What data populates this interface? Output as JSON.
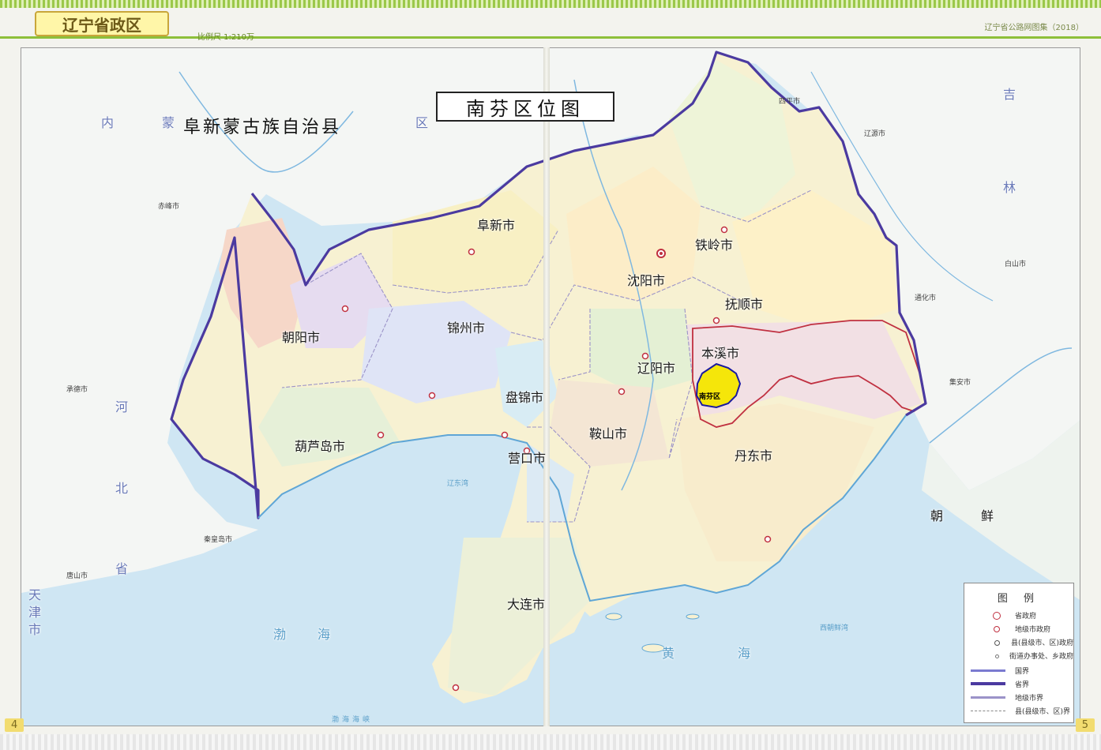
{
  "header": {
    "title": "辽宁省政区",
    "scale": "比例尺 1:210万",
    "series": "辽宁省公路网图集（2018）"
  },
  "map": {
    "title": "南芬区位图",
    "highlight_district": "南芬区",
    "outer_labels": {
      "autonomous_county": "阜新蒙古族自治县",
      "korea": [
        "朝",
        "鲜"
      ],
      "jilin": [
        "吉",
        "林"
      ],
      "hebei": [
        "河",
        "北",
        "省"
      ],
      "tianjin": [
        "天",
        "津",
        "市"
      ],
      "inner_mongolia": [
        "内",
        "蒙",
        "区"
      ]
    },
    "cities": [
      "阜新市",
      "铁岭市",
      "沈阳市",
      "抚顺市",
      "朝阳市",
      "锦州市",
      "本溪市",
      "辽阳市",
      "盘锦市",
      "鞍山市",
      "葫芦岛市",
      "营口市",
      "丹东市",
      "大连市"
    ],
    "outside_places": [
      "赤峰市",
      "承德市",
      "秦皇岛市",
      "唐山市",
      "四平市",
      "辽源市",
      "白山市",
      "通化市",
      "集安市"
    ],
    "water_labels": [
      "渤海",
      "黄海",
      "辽东湾",
      "渤海海峡",
      "西朝鲜湾"
    ],
    "colors": {
      "province_border": "#4b3aa0",
      "city_border": "#c03040",
      "highlight": "#f5e60a",
      "highlight_border": "#1a1aa0",
      "sea": "#cfe6f3",
      "land_outside": "#f4f6f4"
    }
  },
  "legend": {
    "title": "图 例",
    "items": [
      "省政府",
      "地级市政府",
      "县(县级市、区)政府",
      "街道办事处、乡政府",
      "国界",
      "省界",
      "地级市界",
      "县(县级市、区)界"
    ]
  },
  "page_numbers": {
    "left": "4",
    "right": "5"
  }
}
